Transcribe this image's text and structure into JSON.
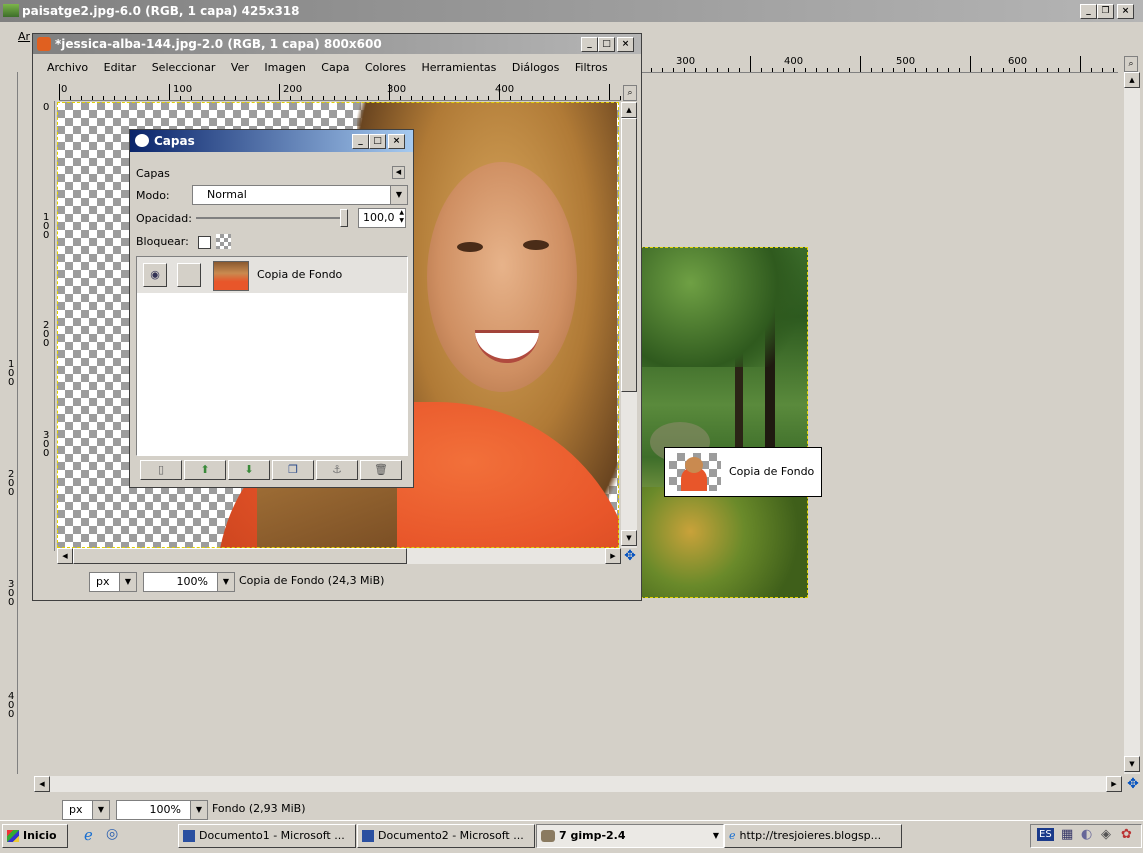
{
  "outer_window": {
    "title": "paisatge2.jpg-6.0 (RGB, 1 capa) 425x318",
    "menu_stub": "Ar",
    "ruler_labels": [
      "300",
      "400",
      "500",
      "600"
    ],
    "vruler_labels": [
      "1\n0\n0",
      "2\n0\n0",
      "3\n0\n0",
      "4\n0\n0"
    ],
    "unit": "px",
    "zoom": "100%",
    "status": "Fondo (2,93 MiB)",
    "drag_tooltip": "Copia de Fondo"
  },
  "inner_window": {
    "title": "*jessica-alba-144.jpg-2.0 (RGB, 1 capa) 800x600",
    "menu": [
      "Archivo",
      "Editar",
      "Seleccionar",
      "Ver",
      "Imagen",
      "Capa",
      "Colores",
      "Herramientas",
      "Diálogos",
      "Filtros"
    ],
    "ruler_labels": [
      "0",
      "100",
      "200",
      "300",
      "400"
    ],
    "vruler_labels": [
      "0",
      "1\n0\n0",
      "2\n0\n0",
      "3\n0\n0"
    ],
    "unit": "px",
    "zoom": "100%",
    "status": "Copia de Fondo (24,3 MiB)"
  },
  "layers_dialog": {
    "title": "Capas",
    "header": "Capas",
    "mode_label": "Modo:",
    "mode_value": "Normal",
    "opacity_label": "Opacidad:",
    "opacity_value": "100,0",
    "opacity_fraction": 1.0,
    "lock_label": "Bloquear:",
    "layer_name": "Copia de Fondo"
  },
  "taskbar": {
    "start": "Inicio",
    "tasks": [
      "Documento1 - Microsoft ...",
      "Documento2 - Microsoft ...",
      "7 gimp-2.4",
      "http://tresjoieres.blogsp..."
    ],
    "tray_lang": "ES"
  },
  "colors": {
    "title_active": "#0a246a",
    "title_inactive": "#808080",
    "dialog_bg": "#d4d0c8",
    "shirt": "#e8562a"
  }
}
